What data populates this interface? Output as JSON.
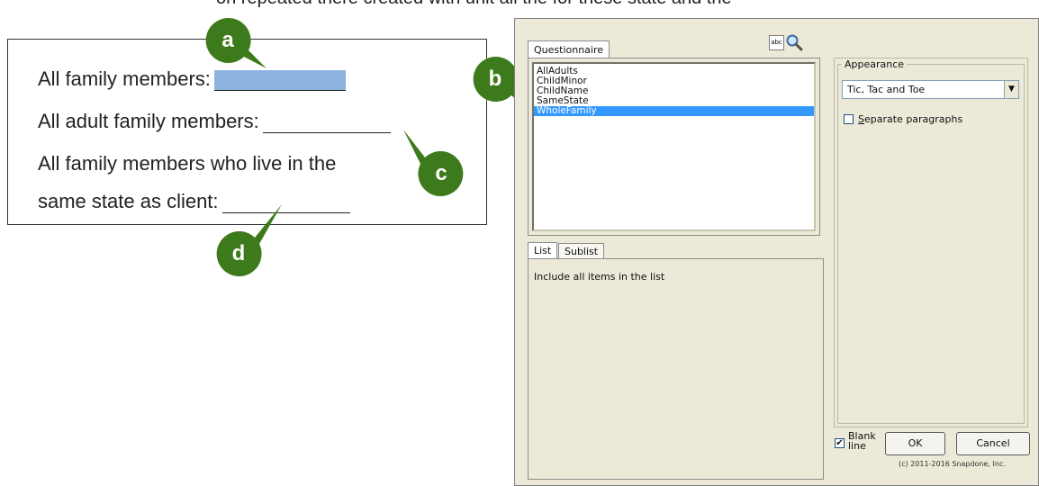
{
  "top_text": "on repeated there created with unit all the for these state and the",
  "document": {
    "line1_label": "All family members:",
    "line2_label": "All adult family members:",
    "line3_label": "All family members who live in the",
    "line4_label": "same state as client:"
  },
  "callouts": {
    "a": "a",
    "b": "b",
    "c": "c",
    "d": "d",
    "color": "#3d7a1b"
  },
  "dialog": {
    "tab_questionnaire": "Questionnaire",
    "abc_button": "abc",
    "list_items": [
      {
        "label": "AllAdults",
        "selected": false
      },
      {
        "label": "ChildMinor",
        "selected": false
      },
      {
        "label": "ChildName",
        "selected": false
      },
      {
        "label": "SameState",
        "selected": false
      },
      {
        "label": "WholeFamily",
        "selected": true
      }
    ],
    "tab_list": "List",
    "tab_sublist": "Sublist",
    "list_description": "Include all items in the list",
    "appearance_label": "Appearance",
    "appearance_value": "Tic, Tac and Toe",
    "separate_paragraphs_label": "Separate paragraphs",
    "separate_paragraphs_checked": false,
    "blank_line_label": "Blank line",
    "blank_line_checked": true,
    "ok_label": "OK",
    "cancel_label": "Cancel",
    "copyright": "(c) 2011-2016 Snapdone, Inc.",
    "selection_color": "#3399ff"
  }
}
